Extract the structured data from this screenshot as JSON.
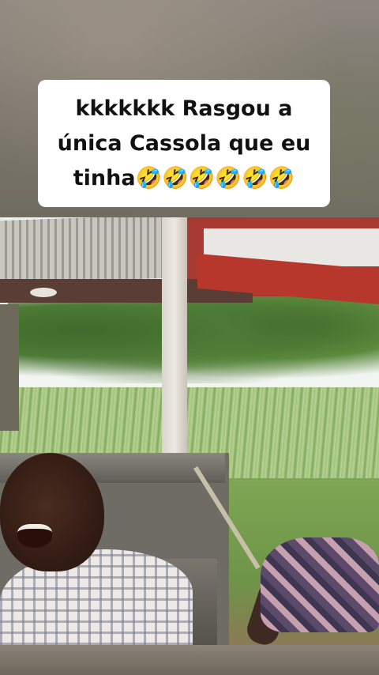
{
  "caption": {
    "text": "kkkkkkk  Rasgou a única Cassola que eu tinha🤣🤣🤣🤣🤣🤣"
  },
  "colors": {
    "caption_background": "#ffffff",
    "caption_text": "#111111",
    "roof_red": "#a83a32"
  }
}
